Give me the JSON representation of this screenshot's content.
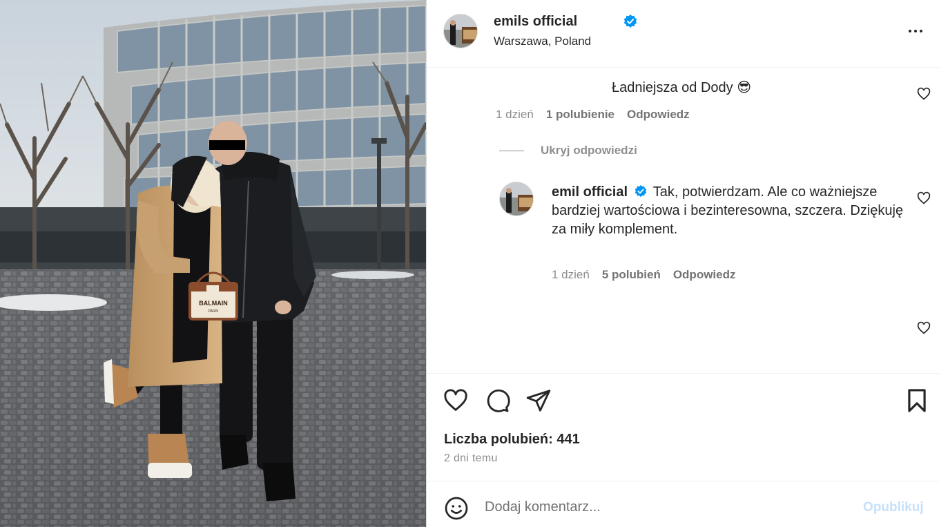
{
  "post": {
    "author_username": "emils          official",
    "location": "Warszawa, Poland",
    "photo_bag_text": "BALMAIN",
    "photo_bag_subtext": "PARIS"
  },
  "comments": [
    {
      "text": "Ładniejsza od Dody 😎",
      "age": "1 dzień",
      "likes": "1 polubienie",
      "reply_label": "Odpowiedz"
    }
  ],
  "hide_replies_label": "Ukryj odpowiedzi",
  "reply": {
    "username": "emil          official",
    "text": "Tak, potwierdzam. Ale co ważniejsze bardziej wartościowa i bezinteresowna, szczera. Dziękuję za miły komplement.",
    "age": "1 dzień",
    "likes": "5 polubień",
    "reply_label": "Odpowiedz"
  },
  "actions": {
    "likes_summary": "Liczba polubień: 441",
    "posted_ago": "2 dni temu"
  },
  "add_comment": {
    "placeholder": "Dodaj komentarz...",
    "publish_label": "Opublikuj"
  },
  "icons": {
    "verified": "verified-badge-icon",
    "more": "more-options-icon",
    "like": "heart-icon",
    "comment": "comment-bubble-icon",
    "share": "paper-plane-icon",
    "save": "bookmark-icon",
    "emoji": "smiley-icon"
  },
  "colors": {
    "verified_blue": "#0095f6",
    "publish_disabled": "#c7e0fa",
    "meta_gray": "#8e8e8e"
  }
}
